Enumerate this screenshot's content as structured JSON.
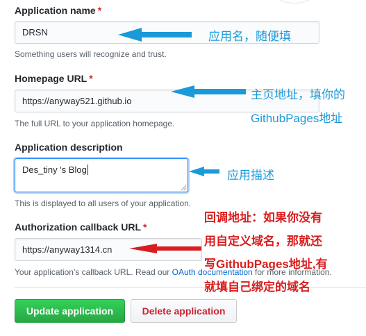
{
  "form": {
    "app_name": {
      "label": "Application name",
      "required_mark": "*",
      "value": "DRSN",
      "hint": "Something users will recognize and trust."
    },
    "homepage": {
      "label": "Homepage URL",
      "required_mark": "*",
      "value": "https://anyway521.github.io",
      "hint": "The full URL to your application homepage."
    },
    "description": {
      "label": "Application description",
      "value": "Des_tiny 's Blog",
      "hint": "This is displayed to all users of your application."
    },
    "callback": {
      "label": "Authorization callback URL",
      "required_mark": "*",
      "value": "https://anyway1314.cn",
      "hint_before": "Your application's callback URL. Read our ",
      "hint_link": "OAuth documentation",
      "hint_after": " for more information."
    }
  },
  "buttons": {
    "update": "Update application",
    "delete": "Delete application"
  },
  "annotations": {
    "app_name_note": "应用名，随便填",
    "homepage_note_line1": "主页地址，填你的",
    "homepage_note_line2": "GithubPages地址",
    "description_note": "应用描述",
    "callback_note_line1": "回调地址：如果你没有",
    "callback_note_line2": "用自定义域名，那就还",
    "callback_note_line3": "写GithubPages地址,有",
    "callback_note_line4": "就填自己绑定的域名"
  },
  "colors": {
    "annotation_blue": "#1a9ad9",
    "annotation_red": "#d81e1e",
    "primary_button": "#28a745",
    "danger_text": "#cb2431",
    "link": "#0366d6"
  }
}
